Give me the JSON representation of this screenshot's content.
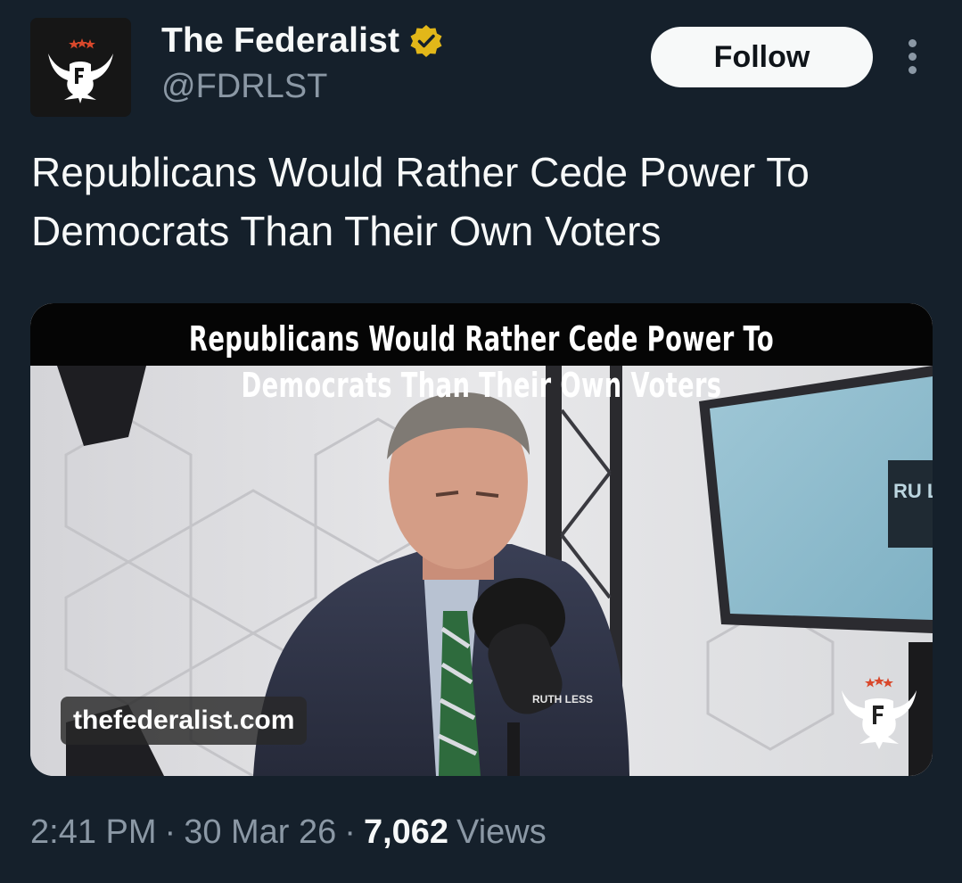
{
  "account": {
    "display_name": "The Federalist",
    "handle": "@FDRLST",
    "avatar_icon": "federalist-eagle-logo",
    "verified_icon": "gold-verified-badge-icon",
    "verified_color": "#e2b719"
  },
  "actions": {
    "follow_label": "Follow",
    "more_icon": "more-vertical-icon"
  },
  "tweet": {
    "text": "Republicans Would Rather Cede Power To Democrats Than Their Own Voters"
  },
  "media": {
    "headline_line1": "Republicans Would Rather Cede Power To",
    "headline_line2": "Democrats Than Their Own Voters",
    "source_label": "thefederalist.com",
    "watermark_icon": "federalist-eagle-logo",
    "mic_label": "RUTH LESS",
    "screen_label": "RU LE"
  },
  "meta": {
    "time": "2:41 PM",
    "separator": "·",
    "date": "30 Mar 26",
    "views_count": "7,062",
    "views_label": "Views"
  },
  "colors": {
    "background": "#15202b",
    "text_primary": "#f7f9f9",
    "text_secondary": "#8b98a5",
    "follow_bg": "#f7f9f9",
    "follow_text": "#0f1419",
    "logo_star_red": "#d9482b"
  }
}
